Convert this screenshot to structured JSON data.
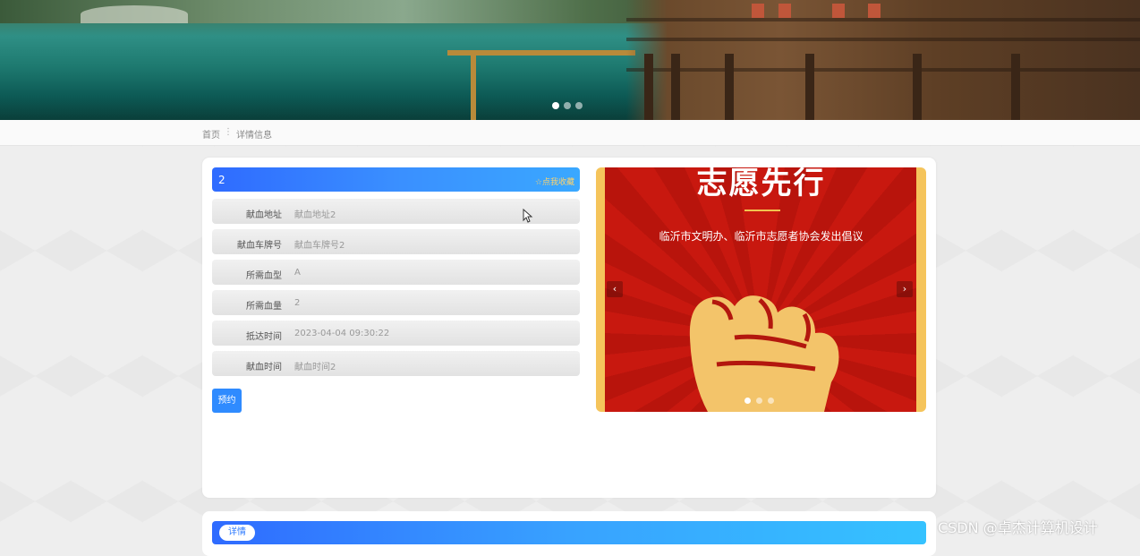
{
  "banner": {
    "carousel_dots": 3,
    "active_dot": 0
  },
  "breadcrumb": {
    "home": "首页",
    "separator": "⋮",
    "current": "详情信息"
  },
  "detail": {
    "title": "2",
    "favorite_label": "☆点我收藏",
    "fields": [
      {
        "label": "献血地址",
        "value": "献血地址2"
      },
      {
        "label": "献血车牌号",
        "value": "献血车牌号2"
      },
      {
        "label": "所需血型",
        "value": "A"
      },
      {
        "label": "所需血量",
        "value": "2"
      },
      {
        "label": "抵达时间",
        "value": "2023-04-04 09:30:22"
      },
      {
        "label": "献血时间",
        "value": "献血时间2"
      }
    ],
    "book_button": "预约"
  },
  "poster": {
    "headline": "志愿先行",
    "subtitle": "临沂市文明办、临沂市志愿者协会发出倡议",
    "prev_icon": "chevron-left-icon",
    "next_icon": "chevron-right-icon",
    "prev_glyph": "‹",
    "next_glyph": "›",
    "active_dot": 0
  },
  "detail_section": {
    "tab_label": "详情"
  },
  "watermark": "CSDN @卓杰计算机设计",
  "colors": {
    "accent": "#2f8bff",
    "poster_red": "#c8180f",
    "poster_gold": "#f5c45b"
  }
}
